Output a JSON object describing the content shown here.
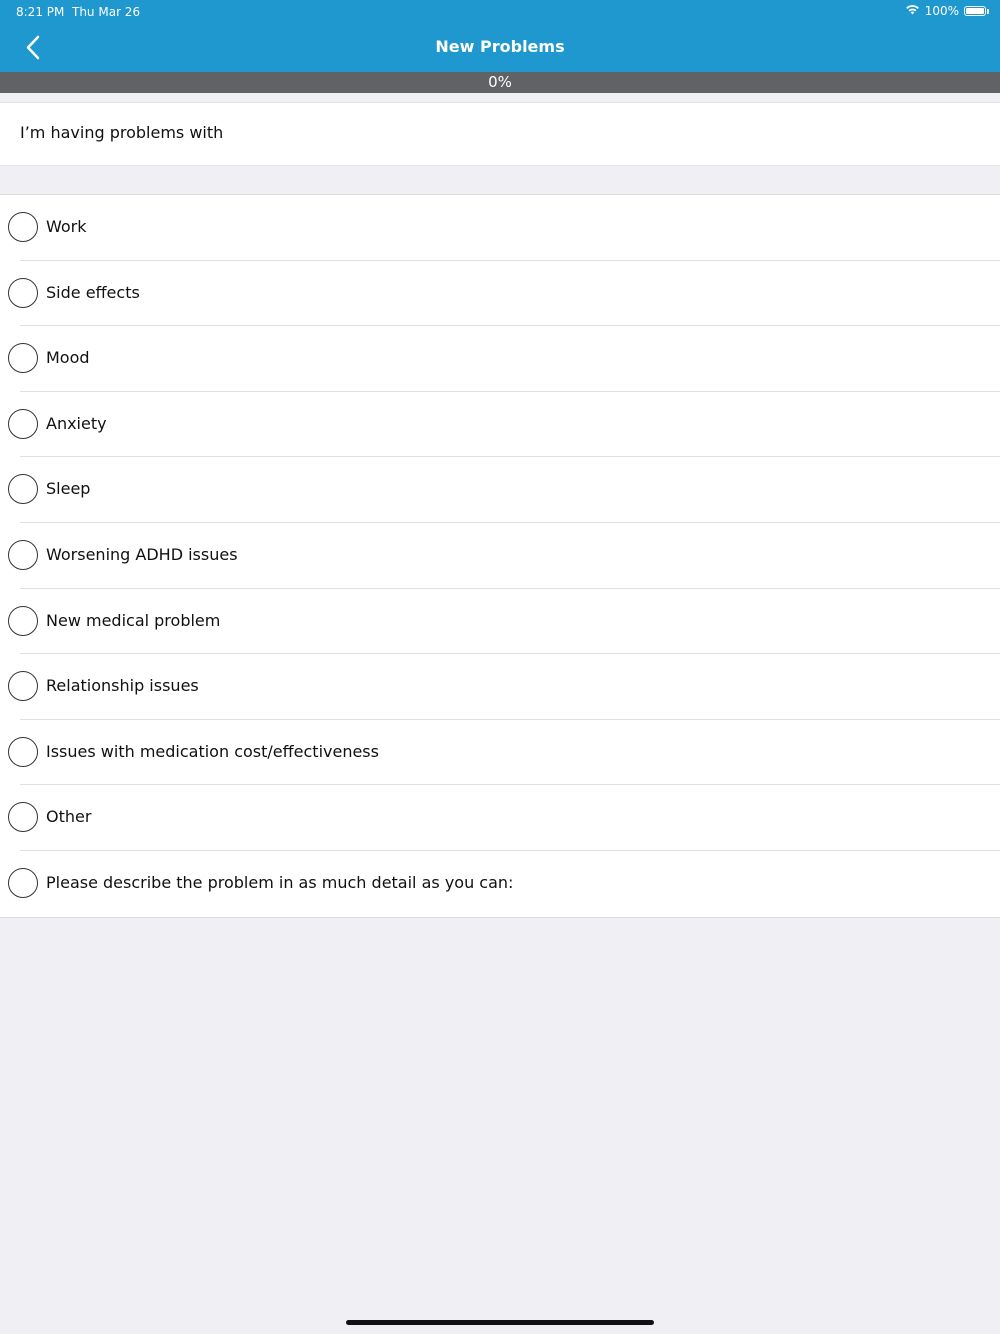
{
  "status_bar": {
    "time": "8:21 PM",
    "date": "Thu Mar 26",
    "battery": "100%",
    "battery_level": 1.0,
    "wifi_icon": "wifi-icon",
    "battery_icon": "battery-icon"
  },
  "nav": {
    "title": "New Problems",
    "back_icon": "chevron-left-icon"
  },
  "progress": {
    "label": "0%",
    "value": 0
  },
  "question": {
    "text": "I’m having problems with"
  },
  "options": [
    {
      "label": "Work",
      "selected": false
    },
    {
      "label": "Side effects",
      "selected": false
    },
    {
      "label": "Mood",
      "selected": false
    },
    {
      "label": "Anxiety",
      "selected": false
    },
    {
      "label": "Sleep",
      "selected": false
    },
    {
      "label": "Worsening ADHD issues",
      "selected": false
    },
    {
      "label": "New medical problem",
      "selected": false
    },
    {
      "label": "Relationship issues",
      "selected": false
    },
    {
      "label": "Issues with medication cost/effectiveness",
      "selected": false
    },
    {
      "label": "Other",
      "selected": false
    },
    {
      "label": "Please describe the problem in as much detail as you can:",
      "selected": false
    }
  ],
  "colors": {
    "accent": "#1f98cf",
    "progress_track": "#606266",
    "background": "#efeff4"
  }
}
